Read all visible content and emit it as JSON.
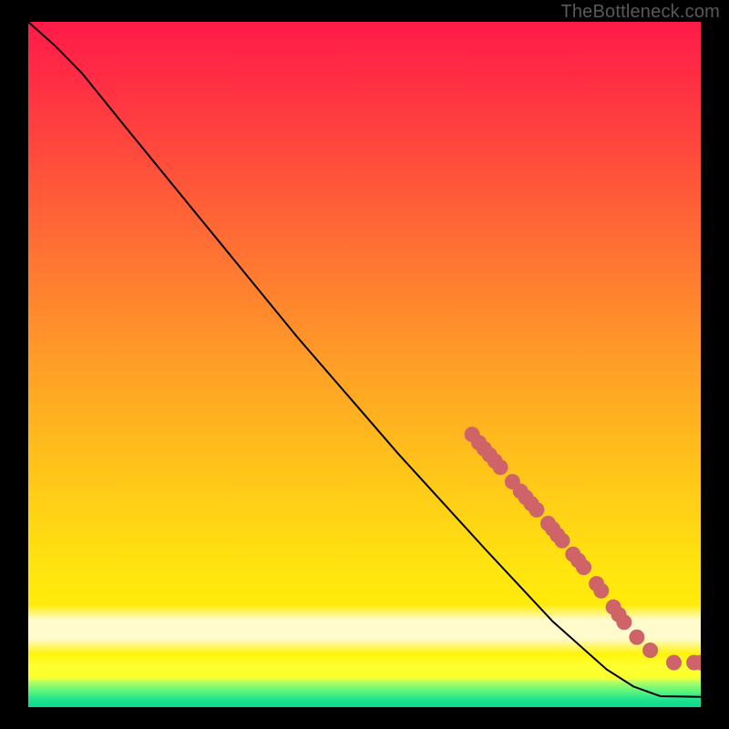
{
  "watermark": "TheBottleneck.com",
  "colors": {
    "gradient_top": "#ff1b49",
    "gradient_mid": "#ffc11b",
    "gradient_yellow": "#fffc00",
    "green_bottom": "#0bd993",
    "curve": "#000000",
    "points": "#ce6368",
    "frame": "#000000"
  },
  "chart_data": {
    "type": "line",
    "title": "",
    "xlabel": "",
    "ylabel": "",
    "xlim": [
      0,
      100
    ],
    "ylim": [
      0,
      100
    ],
    "curve": [
      {
        "x": 0,
        "y": 100
      },
      {
        "x": 4,
        "y": 96.5
      },
      {
        "x": 8,
        "y": 92.5
      },
      {
        "x": 15,
        "y": 84
      },
      {
        "x": 25,
        "y": 72
      },
      {
        "x": 40,
        "y": 54
      },
      {
        "x": 55,
        "y": 37
      },
      {
        "x": 68,
        "y": 23
      },
      {
        "x": 78,
        "y": 12.5
      },
      {
        "x": 86,
        "y": 5.5
      },
      {
        "x": 90,
        "y": 3
      },
      {
        "x": 94,
        "y": 1.6
      },
      {
        "x": 100,
        "y": 1.5
      }
    ],
    "points": [
      {
        "x": 66.0,
        "y": 39.8
      },
      {
        "x": 67.0,
        "y": 38.6
      },
      {
        "x": 67.8,
        "y": 37.7
      },
      {
        "x": 68.6,
        "y": 36.8
      },
      {
        "x": 69.4,
        "y": 35.9
      },
      {
        "x": 70.2,
        "y": 35.0
      },
      {
        "x": 72.0,
        "y": 32.9
      },
      {
        "x": 73.2,
        "y": 31.5
      },
      {
        "x": 74.0,
        "y": 30.6
      },
      {
        "x": 74.8,
        "y": 29.7
      },
      {
        "x": 75.6,
        "y": 28.8
      },
      {
        "x": 77.3,
        "y": 26.8
      },
      {
        "x": 78.0,
        "y": 26.0
      },
      {
        "x": 78.7,
        "y": 25.1
      },
      {
        "x": 79.4,
        "y": 24.3
      },
      {
        "x": 81.0,
        "y": 22.3
      },
      {
        "x": 81.8,
        "y": 21.4
      },
      {
        "x": 82.6,
        "y": 20.4
      },
      {
        "x": 84.5,
        "y": 18.0
      },
      {
        "x": 85.2,
        "y": 17.0
      },
      {
        "x": 87.0,
        "y": 14.6
      },
      {
        "x": 87.8,
        "y": 13.5
      },
      {
        "x": 88.6,
        "y": 12.4
      },
      {
        "x": 90.5,
        "y": 10.2
      },
      {
        "x": 92.5,
        "y": 8.3
      },
      {
        "x": 96.0,
        "y": 6.5
      },
      {
        "x": 99.0,
        "y": 6.5
      },
      {
        "x": 100.0,
        "y": 6.5
      }
    ]
  }
}
